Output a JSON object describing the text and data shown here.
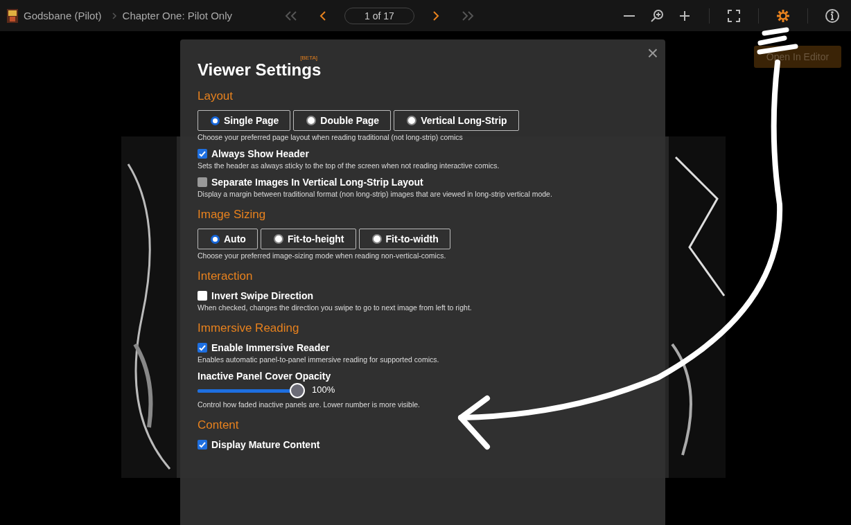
{
  "header": {
    "series": "Godsbane (Pilot)",
    "chapter": "Chapter One: Pilot Only",
    "page": "1 of 17",
    "nav": [
      {
        "kind": "first",
        "disabled": true
      },
      {
        "kind": "prev",
        "disabled": false
      },
      {
        "kind": "next",
        "disabled": false
      },
      {
        "kind": "last",
        "disabled": true
      }
    ],
    "tools": [
      {
        "kind": "zoom-out",
        "selected": false
      },
      {
        "kind": "zoom",
        "selected": false
      },
      {
        "kind": "zoom-in",
        "selected": false
      },
      {
        "kind": "fullscreen",
        "selected": false
      },
      {
        "kind": "settings",
        "selected": true
      },
      {
        "kind": "info",
        "selected": false
      }
    ]
  },
  "editor_button": "Open In Editor",
  "dialog": {
    "title": "Viewer Settings",
    "badge": "[BETA]",
    "close": "×",
    "sections": [
      {
        "heading": "Layout",
        "items": [
          {
            "kind": "radio",
            "options": [
              {
                "label": "Single Page",
                "selected": true
              },
              {
                "label": "Double Page",
                "selected": false
              },
              {
                "label": "Vertical Long-Strip",
                "selected": false
              }
            ],
            "description": "Choose your preferred page layout when reading traditional (not long-strip) comics"
          },
          {
            "kind": "checkbox",
            "label": "Always Show Header",
            "checked": true,
            "disabled": false,
            "description": "Sets the header as always sticky to the top of the screen when not reading interactive comics."
          },
          {
            "kind": "checkbox",
            "label": "Separate Images In Vertical Long-Strip Layout",
            "checked": false,
            "disabled": true,
            "description": "Display a margin between traditional format (non long-strip) images that are viewed in long-strip vertical mode."
          }
        ]
      },
      {
        "heading": "Image Sizing",
        "items": [
          {
            "kind": "radio",
            "options": [
              {
                "label": "Auto",
                "selected": true
              },
              {
                "label": "Fit-to-height",
                "selected": false
              },
              {
                "label": "Fit-to-width",
                "selected": false
              }
            ],
            "description": "Choose your preferred image-sizing mode when reading non-vertical-comics."
          }
        ]
      },
      {
        "heading": "Interaction",
        "items": [
          {
            "kind": "checkbox",
            "label": "Invert Swipe Direction",
            "checked": false,
            "disabled": false,
            "description": "When checked, changes the direction you swipe to go to next image from left to right."
          }
        ]
      },
      {
        "heading": "Immersive Reading",
        "items": [
          {
            "kind": "checkbox",
            "label": "Enable Immersive Reader",
            "checked": true,
            "disabled": false,
            "description": "Enables automatic panel-to-panel immersive reading for supported comics."
          },
          {
            "kind": "slider",
            "label": "Inactive Panel Cover Opacity",
            "level": 1,
            "reading": "100%",
            "description": "Control how faded inactive panels are. Lower number is more visible."
          }
        ]
      },
      {
        "heading": "Content",
        "items": [
          {
            "kind": "checkbox",
            "label": "Display Mature Content",
            "checked": true,
            "disabled": false
          }
        ]
      }
    ]
  }
}
